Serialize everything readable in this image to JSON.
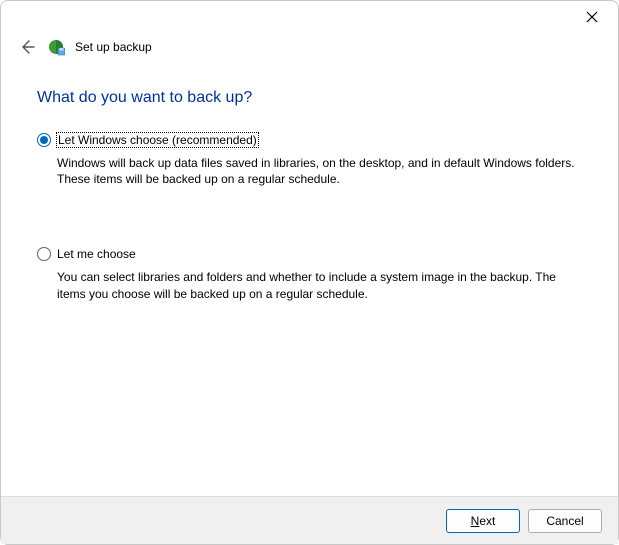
{
  "window": {
    "title": "Set up backup"
  },
  "main": {
    "heading": "What do you want to back up?",
    "options": [
      {
        "label": "Let Windows choose (recommended)",
        "description": "Windows will back up data files saved in libraries, on the desktop, and in default Windows folders. These items will be backed up on a regular schedule.",
        "selected": true
      },
      {
        "label": "Let me choose",
        "description": "You can select libraries and folders and whether to include a system image in the backup. The items you choose will be backed up on a regular schedule.",
        "selected": false
      }
    ]
  },
  "footer": {
    "next_mnemonic": "N",
    "next_rest": "ext",
    "cancel": "Cancel"
  },
  "icons": {
    "close": "close-icon",
    "back": "back-arrow-icon",
    "app": "backup-globe-icon"
  }
}
